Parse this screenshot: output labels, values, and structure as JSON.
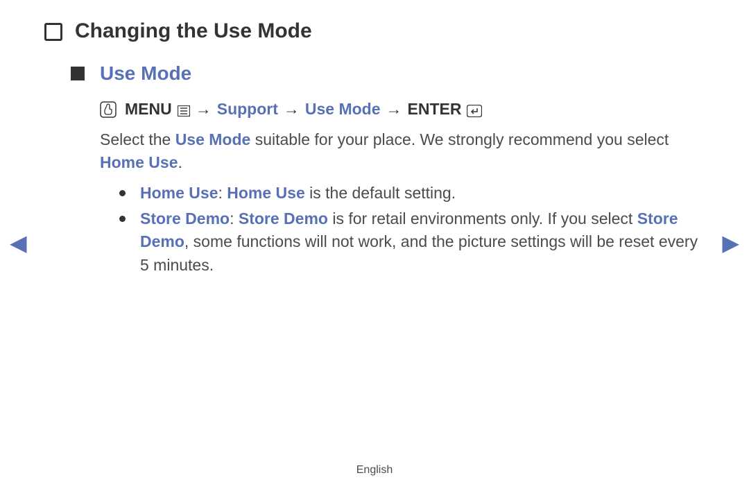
{
  "page": {
    "title": "Changing the Use Mode",
    "subtitle": "Use Mode",
    "footer_language": "English"
  },
  "nav_path": {
    "menu_label": "MENU",
    "items": [
      "Support",
      "Use Mode"
    ],
    "enter_label": "ENTER",
    "arrow": "→"
  },
  "intro": {
    "part1": "Select the ",
    "term1": "Use Mode",
    "part2": " suitable for your place. We strongly recommend you select ",
    "term2": "Home Use",
    "part3": "."
  },
  "bullets": {
    "home_use": {
      "label": "Home Use",
      "sep": ": ",
      "label2": "Home Use",
      "rest": " is the default setting."
    },
    "store_demo": {
      "label": "Store Demo",
      "sep": ": ",
      "label2": "Store Demo",
      "rest1": " is for retail environments only. If you select ",
      "label3": "Store Demo",
      "rest2": ", some functions will not work, and the picture settings will be reset every 5 minutes."
    }
  }
}
